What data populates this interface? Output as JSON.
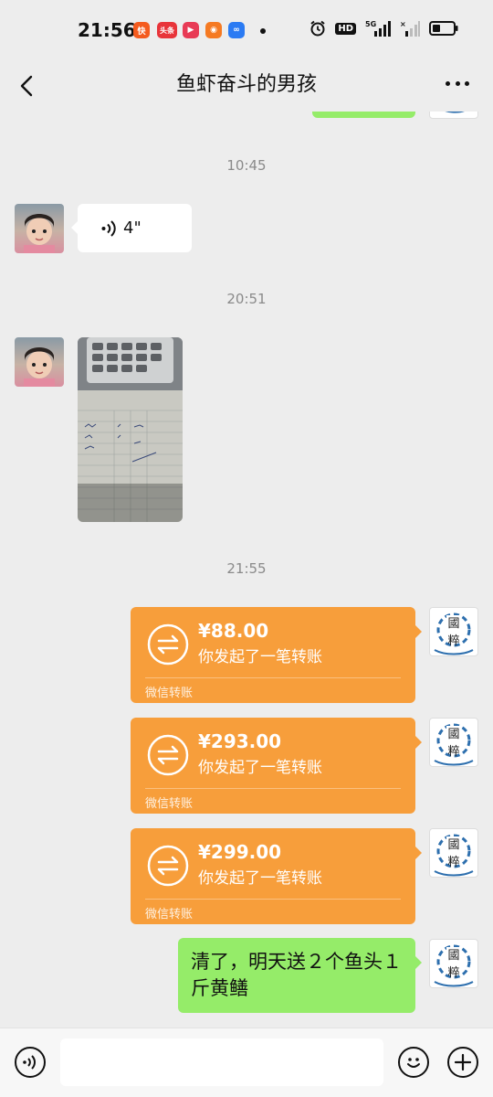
{
  "status_bar": {
    "time": "21:56",
    "apps": [
      {
        "name": "kuaishou-icon",
        "color": "#F45B1E",
        "glyph": "快"
      },
      {
        "name": "toutiao-icon",
        "color": "#E8343A",
        "glyph": "头条"
      },
      {
        "name": "video-icon",
        "color": "#E83A55",
        "glyph": "▶"
      },
      {
        "name": "camera-app-icon",
        "color": "#F57A22",
        "glyph": "◉"
      },
      {
        "name": "infinity-app-icon",
        "color": "#2B7BF3",
        "glyph": "∞"
      }
    ],
    "network": "5G",
    "hd": "HD"
  },
  "header": {
    "title": "鱼虾奋斗的男孩"
  },
  "chat": {
    "timestamps": [
      "10:45",
      "20:51",
      "21:55"
    ],
    "voice_message": {
      "duration": "4\""
    },
    "transfers": [
      {
        "amount": "¥88.00",
        "desc": "你发起了一笔转账",
        "footer": "微信转账"
      },
      {
        "amount": "¥293.00",
        "desc": "你发起了一笔转账",
        "footer": "微信转账"
      },
      {
        "amount": "¥299.00",
        "desc": "你发起了一笔转账",
        "footer": "微信转账"
      }
    ],
    "text_message": "清了，明天送２个鱼头１斤黄鳝"
  },
  "colors": {
    "background": "#EDEDED",
    "transfer": "#F79E3B",
    "self_bubble": "#95EC69"
  },
  "input_bar": {
    "placeholder": ""
  }
}
